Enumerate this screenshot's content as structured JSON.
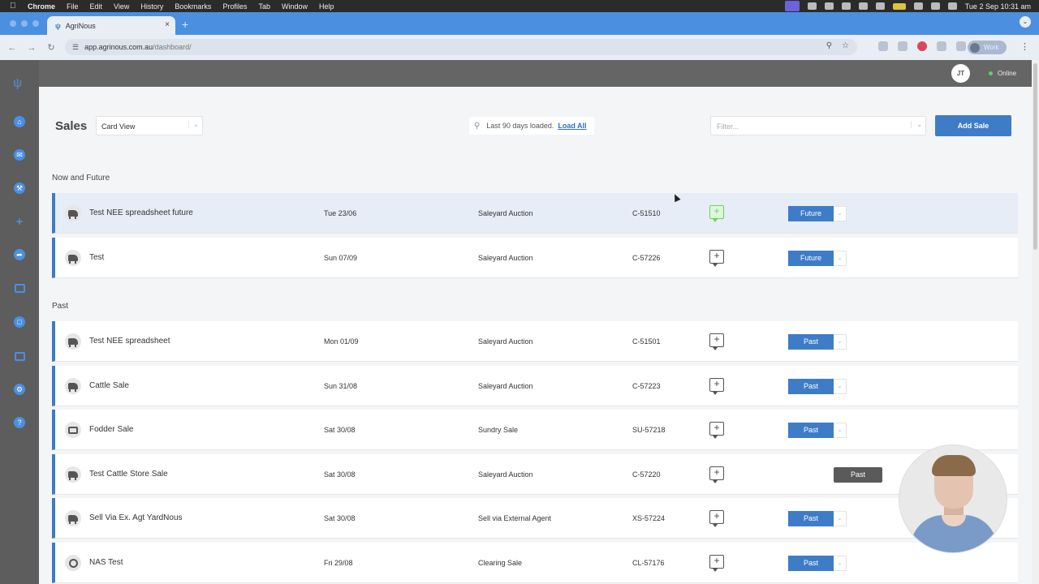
{
  "mac": {
    "menus": [
      "Chrome",
      "File",
      "Edit",
      "View",
      "History",
      "Bookmarks",
      "Profiles",
      "Tab",
      "Window",
      "Help"
    ],
    "clock": "Tue 2 Sep  10:31 am"
  },
  "browser": {
    "tab_title": "AgriNous",
    "url_host": "app.agrinous.com.au",
    "url_path": "/dashboard/",
    "profile": "Work"
  },
  "header": {
    "user_initials": "JT",
    "status": "Online"
  },
  "toolbar": {
    "title": "Sales",
    "view": "Card View",
    "load_info": "Last 90 days loaded.",
    "load_all": "Load All",
    "filter_placeholder": "Filter...",
    "add_sale": "Add Sale"
  },
  "sections": {
    "now_future": "Now and Future",
    "past": "Past"
  },
  "now_future_rows": [
    {
      "name": "Test NEE spreadsheet future",
      "date": "Tue 23/06",
      "type": "Saleyard Auction",
      "code": "C-51510",
      "status": "Future",
      "icon": "cattle-icon"
    },
    {
      "name": "Test",
      "date": "Sun 07/09",
      "type": "Saleyard Auction",
      "code": "C-57226",
      "status": "Future",
      "icon": "cattle-icon"
    }
  ],
  "past_rows": [
    {
      "name": "Test NEE spreadsheet",
      "date": "Mon 01/09",
      "type": "Saleyard Auction",
      "code": "C-51501",
      "status": "Past",
      "icon": "cattle-icon"
    },
    {
      "name": "Cattle Sale",
      "date": "Sun 31/08",
      "type": "Saleyard Auction",
      "code": "C-57223",
      "status": "Past",
      "icon": "cattle-icon"
    },
    {
      "name": "Fodder Sale",
      "date": "Sat 30/08",
      "type": "Sundry Sale",
      "code": "SU-57218",
      "status": "Past",
      "icon": "box-icon"
    },
    {
      "name": "Test Cattle Store Sale",
      "date": "Sat 30/08",
      "type": "Saleyard Auction",
      "code": "C-57220",
      "status": "Past",
      "icon": "cattle-icon"
    },
    {
      "name": "Sell Via Ex. Agt YardNous",
      "date": "Sat 30/08",
      "type": "Sell via External Agent",
      "code": "XS-57224",
      "status": "Past",
      "icon": "cattle-icon"
    },
    {
      "name": "NAS Test",
      "date": "Fri 29/08",
      "type": "Clearing Sale",
      "code": "CL-57176",
      "status": "Past",
      "icon": "tractor-icon"
    }
  ],
  "tooltip": "Past"
}
